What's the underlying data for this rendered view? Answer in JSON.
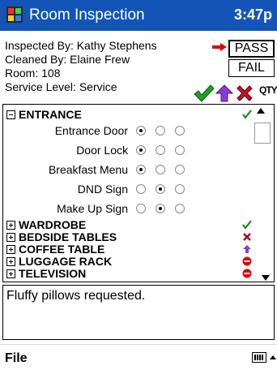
{
  "titlebar": {
    "title": "Room Inspection",
    "time": "3:47p",
    "icon": "app-window-icon",
    "bg_color": "#1255b7"
  },
  "header": {
    "inspected_by": "Inspected By: Kathy Stephens",
    "cleaned_by": "Cleaned By: Elaine Frew",
    "room": "Room: 108",
    "service_level": "Service Level: Service",
    "pass_label": "PASS",
    "fail_label": "FAIL",
    "selected_result": "PASS",
    "toolbar_icons": [
      "green-check-icon",
      "purple-up-arrow-icon",
      "red-x-icon"
    ],
    "qty_label": "QTY"
  },
  "checklist": {
    "sections": [
      {
        "name": "ENTRANCE",
        "expanded": true,
        "status_icon": "green-check-icon",
        "status_color": "#1a8a1a",
        "items": [
          {
            "label": "Entrance Door",
            "selected": 0
          },
          {
            "label": "Door Lock",
            "selected": 0
          },
          {
            "label": "Breakfast Menu",
            "selected": 0
          },
          {
            "label": "DND Sign",
            "selected": 1
          },
          {
            "label": "Make Up Sign",
            "selected": 1
          }
        ]
      },
      {
        "name": "WARDROBE",
        "expanded": false,
        "status_icon": "green-check-icon",
        "status_color": "#1a8a1a"
      },
      {
        "name": "BEDSIDE TABLES",
        "expanded": false,
        "status_icon": "red-x-icon",
        "status_color": "#b00020"
      },
      {
        "name": "COFFEE TABLE",
        "expanded": false,
        "status_icon": "purple-up-arrow-icon",
        "status_color": "#8a3bd6"
      },
      {
        "name": "LUGGAGE RACK",
        "expanded": false,
        "status_icon": "red-minus-icon",
        "status_color": "#e00000"
      },
      {
        "name": "TELEVISION",
        "expanded": false,
        "status_icon": "red-minus-icon",
        "status_color": "#e00000"
      }
    ]
  },
  "notes": {
    "text": "Fluffy pillows requested."
  },
  "commandbar": {
    "file_label": "File",
    "keyboard_icon": "keyboard-icon"
  }
}
